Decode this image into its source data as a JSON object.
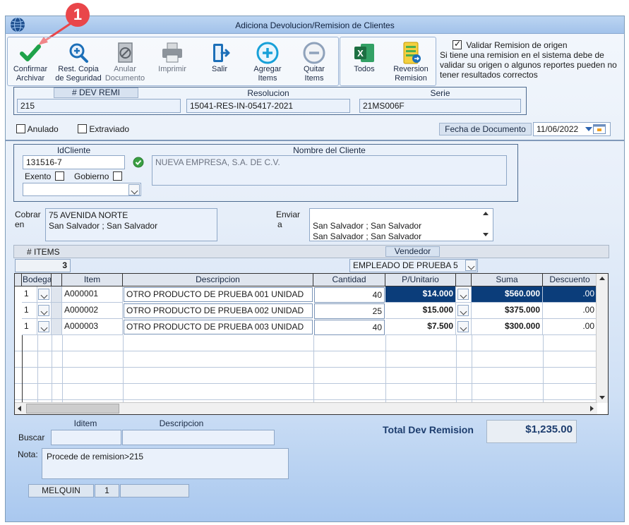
{
  "window": {
    "title": "Adiciona Devolucion/Remision de Clientes"
  },
  "callout": {
    "number": "1"
  },
  "toolbar": {
    "confirm": [
      "Confirmar",
      "Archivar"
    ],
    "backup": [
      "Rest. Copia",
      "de Seguridad"
    ],
    "cancel_doc": [
      "Anular",
      "Documento"
    ],
    "print": "Imprimir",
    "exit": "Salir",
    "add_items": [
      "Agregar",
      "Items"
    ],
    "remove_items": [
      "Quitar",
      "Items"
    ],
    "excel_all": "Todos",
    "reversal": [
      "Reversion",
      "Remision"
    ]
  },
  "validation": {
    "label": "Validar Remision de origen",
    "checked": true,
    "note": "Si tiene una remision en el sistema debe de validar su origen o algunos reportes pueden no tener resultados correctos"
  },
  "header": {
    "dev_remi_label": "# DEV REMI",
    "dev_remi": "215",
    "resolucion_label": "Resolucion",
    "resolucion": "15041-RES-IN-05417-2021",
    "serie_label": "Serie",
    "serie": "21MS006F"
  },
  "flags": {
    "anulado": "Anulado",
    "extraviado": "Extraviado"
  },
  "fecha": {
    "label": "Fecha de  Documento",
    "value": "11/06/2022"
  },
  "client": {
    "id_label": "IdCliente",
    "id": "131516-7",
    "name_label": "Nombre del Cliente",
    "name": "NUEVA EMPRESA, S.A. DE C.V.",
    "exento": "Exento",
    "gobierno": "Gobierno"
  },
  "cobrar": {
    "label1": "Cobrar",
    "label2": "en",
    "line1": "75 AVENIDA NORTE",
    "line2": "San Salvador ; San Salvador"
  },
  "enviar": {
    "label1": "Enviar",
    "label2": "a",
    "line1": "San Salvador ; San Salvador",
    "line2": "San Salvador ; San Salvador"
  },
  "items_summary": {
    "label": "# ITEMS",
    "count": "3",
    "vendedor_label": "Vendedor",
    "vendedor": "EMPLEADO DE PRUEBA 5"
  },
  "grid": {
    "columns": [
      "Bodega",
      "Item",
      "Descripcion",
      "Cantidad",
      "P/Unitario",
      "Suma",
      "Descuento"
    ],
    "rows": [
      {
        "bodega": "1",
        "item": "A000001",
        "descripcion": "OTRO PRODUCTO DE PRUEBA 001 UNIDAD",
        "cantidad": "40",
        "unitario": "$14.000",
        "suma": "$560.000",
        "descuento": ".00"
      },
      {
        "bodega": "1",
        "item": "A000002",
        "descripcion": "OTRO PRODUCTO DE PRUEBA 002 UNIDAD",
        "cantidad": "25",
        "unitario": "$15.000",
        "suma": "$375.000",
        "descuento": ".00"
      },
      {
        "bodega": "1",
        "item": "A000003",
        "descripcion": "OTRO PRODUCTO DE PRUEBA 003 UNIDAD",
        "cantidad": "40",
        "unitario": "$7.500",
        "suma": "$300.000",
        "descuento": ".00"
      }
    ]
  },
  "search": {
    "label": "Buscar",
    "iditem_label": "Iditem",
    "desc_label": "Descripcion"
  },
  "nota": {
    "label": "Nota:",
    "value": "Procede de remision>215"
  },
  "total": {
    "label": "Total Dev Remision",
    "value": "$1,235.00"
  },
  "footer": {
    "user": "MELQUIN",
    "num": "1"
  },
  "colors": {
    "accent": "#0b3d7a",
    "callout": "#e9464a",
    "confirm_green": "#1fa24a"
  }
}
